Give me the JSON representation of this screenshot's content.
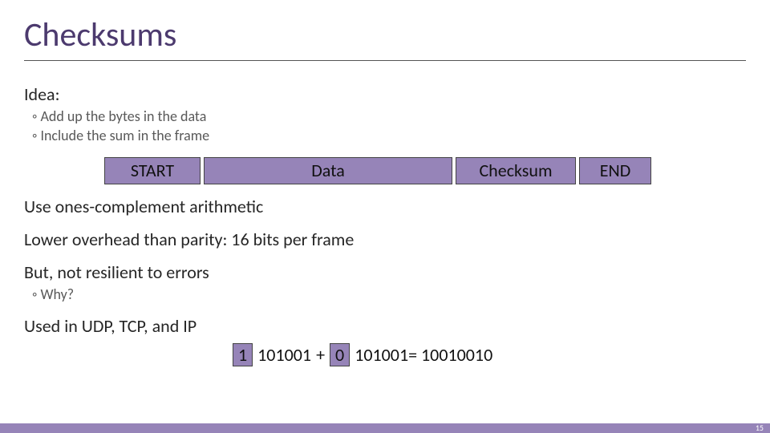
{
  "title": "Checksums",
  "idea_heading": "Idea:",
  "idea_points": {
    "p1": "◦ Add up the bytes in the data",
    "p2": "◦ Include the sum in the frame"
  },
  "frame": {
    "start": "START",
    "data": "Data",
    "checksum": "Checksum",
    "end": "END"
  },
  "body": {
    "line1": "Use ones-complement arithmetic",
    "line2": "Lower overhead than parity: 16 bits per frame",
    "line3": "But, not resilient to errors",
    "why": "◦ Why?",
    "line4": "Used in UDP, TCP, and IP"
  },
  "math": {
    "b1": "1",
    "n1": "101001",
    "plus": "+",
    "b2": "0",
    "rest": "101001= 10010010"
  },
  "page": "15"
}
